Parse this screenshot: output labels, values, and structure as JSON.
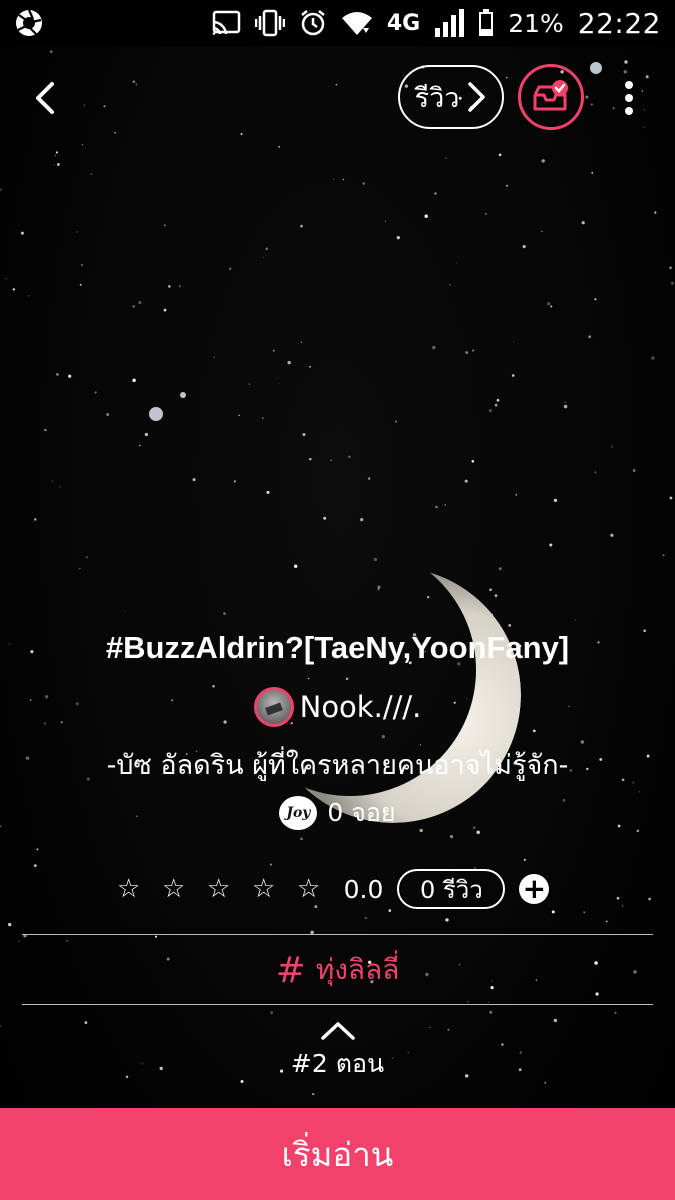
{
  "status_bar": {
    "battery": "21%",
    "network": "4G",
    "time": "22:22"
  },
  "header": {
    "review_label": "รีวิว",
    "icons": [
      "back-chevron",
      "right-chevron",
      "bookshelf-check",
      "more-vertical"
    ]
  },
  "story": {
    "title": "#BuzzAldrin?[TaeNy,YoonFany]",
    "author": "Nook.///.",
    "description": "-บัซ อัลดริน ผู้ที่ใครหลายคนอาจไม่รู้จัก-",
    "joy_badge": "Joy",
    "joy_count": "0 จอย"
  },
  "rating": {
    "stars_filled": 0,
    "stars_total": 5,
    "score": "0.0",
    "review_count": "0 รีวิว",
    "add_symbol": "+"
  },
  "tag": {
    "symbol": "#",
    "label": "ทุ่งลิลลี่"
  },
  "chapter": {
    "label": "#2 ตอน"
  },
  "start_button": {
    "label": "เริ่มอ่าน"
  },
  "colors": {
    "accent": "#f2426c",
    "background": "#000000",
    "text": "#ffffff"
  }
}
